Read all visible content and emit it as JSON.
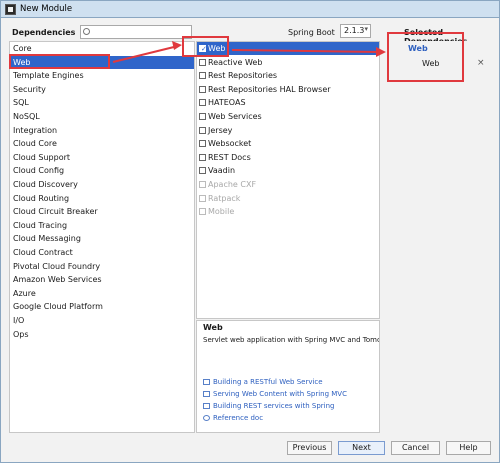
{
  "window": {
    "title": "New Module"
  },
  "header": {
    "dependencies_label": "Dependencies",
    "search_value": "",
    "spring_boot_label": "Spring Boot",
    "spring_boot_version": "2.1.3",
    "selected_label": "Selected Dependencies"
  },
  "categories": [
    "Core",
    "Web",
    "Template Engines",
    "Security",
    "SQL",
    "NoSQL",
    "Integration",
    "Cloud Core",
    "Cloud Support",
    "Cloud Config",
    "Cloud Discovery",
    "Cloud Routing",
    "Cloud Circuit Breaker",
    "Cloud Tracing",
    "Cloud Messaging",
    "Cloud Contract",
    "Pivotal Cloud Foundry",
    "Amazon Web Services",
    "Azure",
    "Google Cloud Platform",
    "I/O",
    "Ops"
  ],
  "selected_category_index": 1,
  "dependencies": [
    {
      "label": "Web",
      "checked": true,
      "enabled": true
    },
    {
      "label": "Reactive Web",
      "checked": false,
      "enabled": true
    },
    {
      "label": "Rest Repositories",
      "checked": false,
      "enabled": true
    },
    {
      "label": "Rest Repositories HAL Browser",
      "checked": false,
      "enabled": true
    },
    {
      "label": "HATEOAS",
      "checked": false,
      "enabled": true
    },
    {
      "label": "Web Services",
      "checked": false,
      "enabled": true
    },
    {
      "label": "Jersey",
      "checked": false,
      "enabled": true
    },
    {
      "label": "Websocket",
      "checked": false,
      "enabled": true
    },
    {
      "label": "REST Docs",
      "checked": false,
      "enabled": true
    },
    {
      "label": "Vaadin",
      "checked": false,
      "enabled": true
    },
    {
      "label": "Apache CXF",
      "checked": false,
      "enabled": false
    },
    {
      "label": "Ratpack",
      "checked": false,
      "enabled": false
    },
    {
      "label": "Mobile",
      "checked": false,
      "enabled": false
    }
  ],
  "selected_dependency_index": 0,
  "description": {
    "title": "Web",
    "text": "Servlet web application with Spring MVC and Tomcat",
    "guides": [
      {
        "label": "Building a RESTful Web Service",
        "icon": "guide-icon"
      },
      {
        "label": "Serving Web Content with Spring MVC",
        "icon": "guide-icon"
      },
      {
        "label": "Building REST services with Spring",
        "icon": "guide-icon"
      },
      {
        "label": "Reference doc",
        "icon": "reference-icon"
      }
    ]
  },
  "selected_panel": {
    "group": "Web",
    "items": [
      "Web"
    ],
    "remove_glyph": "×"
  },
  "buttons": {
    "previous": "Previous",
    "next": "Next",
    "cancel": "Cancel",
    "help": "Help"
  },
  "colors": {
    "selection": "#2f65ca",
    "link": "#2d5fbf",
    "annotation": "#e0393e"
  }
}
